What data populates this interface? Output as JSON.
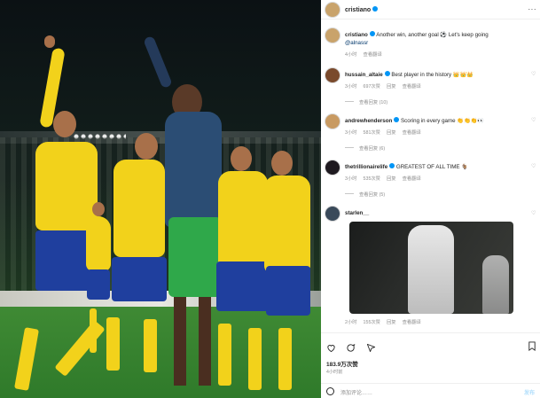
{
  "post": {
    "author": "cristiano",
    "caption_author": "cristiano",
    "caption_text": "Another win, another goal ⚽️ Let's keep going",
    "caption_mention": "@alnassr",
    "caption_time": "4小时",
    "caption_translate": "查看翻译",
    "more_icon": "···"
  },
  "comments": [
    {
      "user": "hussain_altaie",
      "text": "Best player in the history 👑👑👑",
      "time": "3小时",
      "likes": "697次赞",
      "reply": "回复",
      "translate": "查看翻译",
      "view_replies": "查看回复 (10)"
    },
    {
      "user": "andrewhenderson",
      "text": "Scoring in every game 👏👏👏👀",
      "time": "3小时",
      "likes": "581次赞",
      "reply": "回复",
      "translate": "查看翻译",
      "view_replies": "查看回复 (6)"
    },
    {
      "user": "thetrillionairelife",
      "text": "GREATEST OF ALL TIME 🐐",
      "time": "3小时",
      "likes": "535次赞",
      "reply": "回复",
      "translate": "查看翻译",
      "view_replies": "查看回复 (5)"
    },
    {
      "user": "starlen__",
      "text": "",
      "time": "2小时",
      "likes": "155次赞",
      "reply": "回复",
      "translate": "查看翻译"
    }
  ],
  "footer": {
    "likes_count": "183.9万次赞",
    "post_time": "4小时前",
    "add_comment_placeholder": "添加评论……",
    "post_button": "发布"
  },
  "colors": {
    "verified": "#0095f6",
    "link": "#00376b",
    "jersey": "#f2d21b",
    "shorts": "#1f3f9e"
  }
}
